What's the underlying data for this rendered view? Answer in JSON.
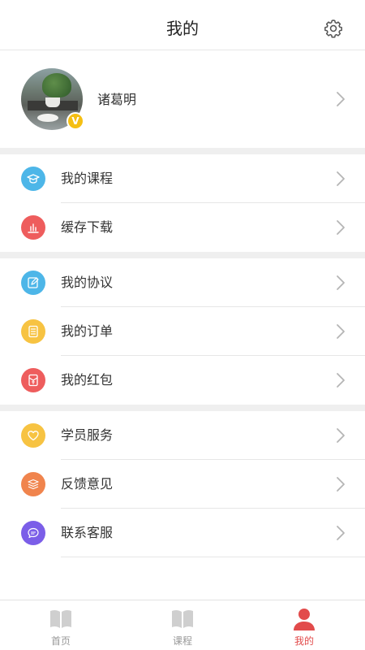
{
  "header": {
    "title": "我的"
  },
  "profile": {
    "name": "诸葛明",
    "badge": "V"
  },
  "groups": [
    [
      {
        "label": "我的课程",
        "icon": "graduation-cap-icon",
        "color": "#4db6e8"
      },
      {
        "label": "缓存下载",
        "icon": "bar-chart-icon",
        "color": "#ee5d5d"
      }
    ],
    [
      {
        "label": "我的协议",
        "icon": "edit-document-icon",
        "color": "#4db6e8"
      },
      {
        "label": "我的订单",
        "icon": "order-list-icon",
        "color": "#f7c342"
      },
      {
        "label": "我的红包",
        "icon": "red-packet-icon",
        "color": "#ee5d5d"
      }
    ],
    [
      {
        "label": "学员服务",
        "icon": "heart-icon",
        "color": "#f7c342"
      },
      {
        "label": "反馈意见",
        "icon": "books-icon",
        "color": "#f0844d"
      },
      {
        "label": "联系客服",
        "icon": "chat-bubble-icon",
        "color": "#7b5ee8"
      }
    ]
  ],
  "tabbar": {
    "items": [
      {
        "label": "首页",
        "icon": "book-icon",
        "active": false
      },
      {
        "label": "课程",
        "icon": "book-icon",
        "active": false
      },
      {
        "label": "我的",
        "icon": "person-icon",
        "active": true
      }
    ]
  },
  "colors": {
    "accent": "#e24b4b",
    "separator": "#efefef",
    "badge": "#f5bf13"
  }
}
